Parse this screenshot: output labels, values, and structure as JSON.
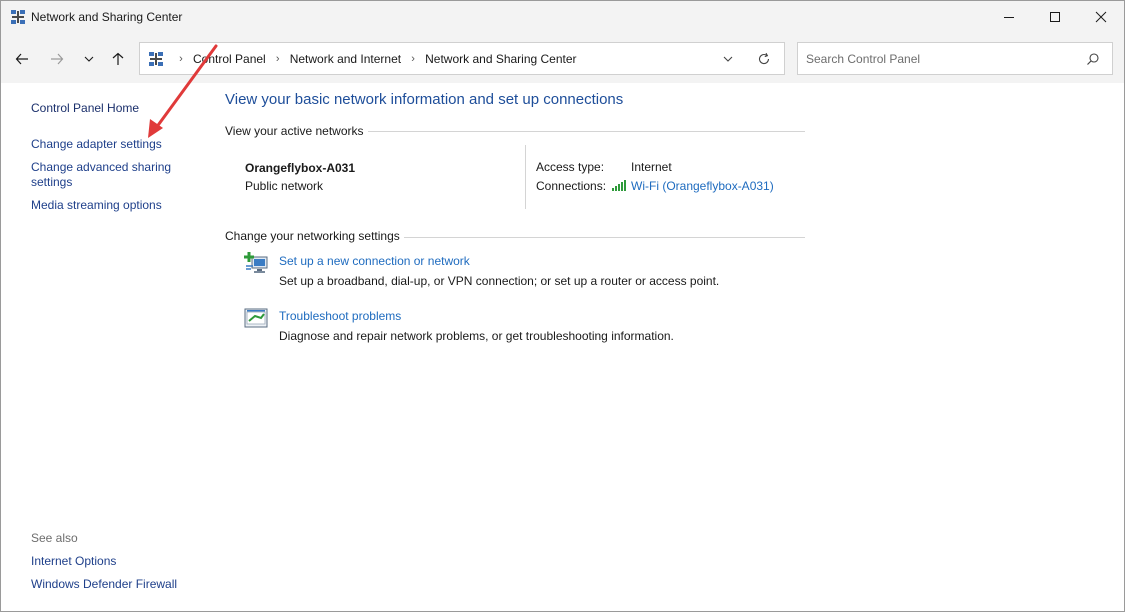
{
  "window": {
    "title": "Network and Sharing Center",
    "app_icon": "network-center-icon"
  },
  "nav": {
    "breadcrumbs": [
      "Control Panel",
      "Network and Internet",
      "Network and Sharing Center"
    ],
    "search_placeholder": "Search Control Panel"
  },
  "sidebar": {
    "links": [
      "Control Panel Home",
      "Change adapter settings",
      "Change advanced sharing settings",
      "Media streaming options"
    ],
    "see_also_label": "See also",
    "see_also_links": [
      "Internet Options",
      "Windows Defender Firewall"
    ]
  },
  "main": {
    "heading": "View your basic network information and set up connections",
    "active_networks_label": "View your active networks",
    "network": {
      "name": "Orangeflybox-A031",
      "type": "Public network",
      "access_type_label": "Access type:",
      "access_type_value": "Internet",
      "connections_label": "Connections:",
      "connection_link": "Wi-Fi (Orangeflybox-A031)"
    },
    "change_settings_label": "Change your networking settings",
    "tasks": [
      {
        "icon": "new-connection-icon",
        "link": "Set up a new connection or network",
        "description": "Set up a broadband, dial-up, or VPN connection; or set up a router or access point."
      },
      {
        "icon": "troubleshoot-icon",
        "link": "Troubleshoot problems",
        "description": "Diagnose and repair network problems, or get troubleshooting information."
      }
    ]
  },
  "colors": {
    "link_blue": "#1e6bbf",
    "heading_blue": "#1e4e9a",
    "annotation_red": "#e03a3a"
  }
}
